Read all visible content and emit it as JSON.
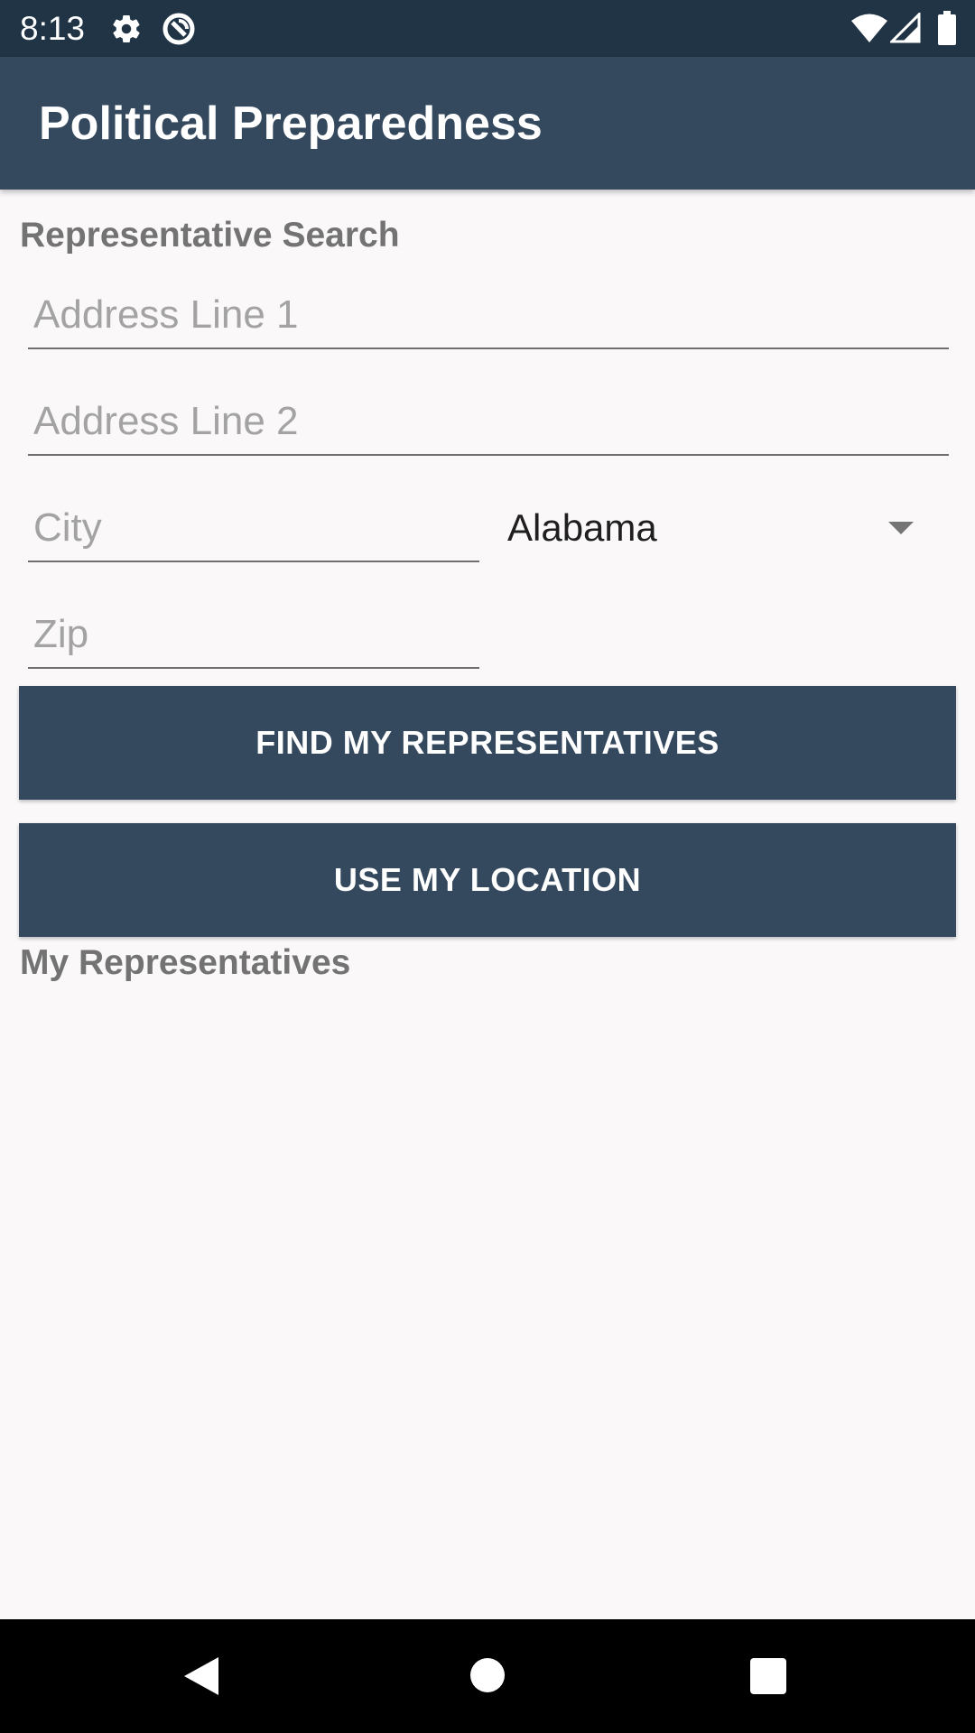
{
  "status_bar": {
    "time": "8:13",
    "icons": [
      "gear-icon",
      "sync-circle-icon",
      "wifi-icon",
      "signal-icon",
      "battery-icon"
    ]
  },
  "app_bar": {
    "title": "Political Preparedness"
  },
  "search": {
    "section_title": "Representative Search",
    "address1_placeholder": "Address Line 1",
    "address2_placeholder": "Address Line 2",
    "city_placeholder": "City",
    "zip_placeholder": "Zip",
    "state_selected": "Alabama",
    "find_button_label": "FIND MY REPRESENTATIVES",
    "location_button_label": "USE MY LOCATION"
  },
  "results": {
    "section_title": "My Representatives"
  },
  "nav_bar": {
    "icons": [
      "back-icon",
      "home-icon",
      "recents-icon"
    ]
  },
  "colors": {
    "status_bar_bg": "#203446",
    "primary": "#35495e",
    "background": "#faf8f9",
    "section_text": "#737373",
    "placeholder": "#a3a3a3"
  }
}
